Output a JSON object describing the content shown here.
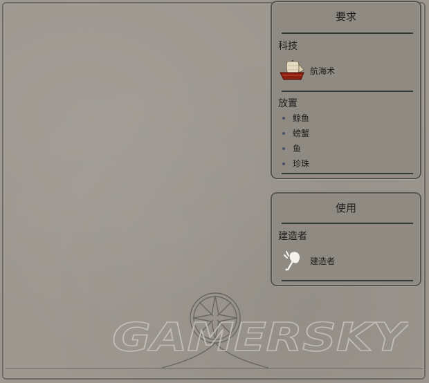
{
  "requirements_panel": {
    "title": "要求",
    "tech_label": "科技",
    "tech_item": {
      "label": "航海术",
      "icon": "ship-icon"
    },
    "placement_label": "放置",
    "placement_items": [
      "鲸鱼",
      "螃蟹",
      "鱼",
      "珍珠"
    ]
  },
  "usage_panel": {
    "title": "使用",
    "unit_label": "建造者",
    "unit_item": {
      "label": "建造者",
      "icon": "builder-hammer-icon"
    }
  },
  "watermark": {
    "text": "GAMERSKY"
  },
  "colors": {
    "parchment": "#9c978f",
    "panel_bg": "#8f8a82",
    "rule": "#2f3a38",
    "ship_hull": "#8a1f12"
  }
}
